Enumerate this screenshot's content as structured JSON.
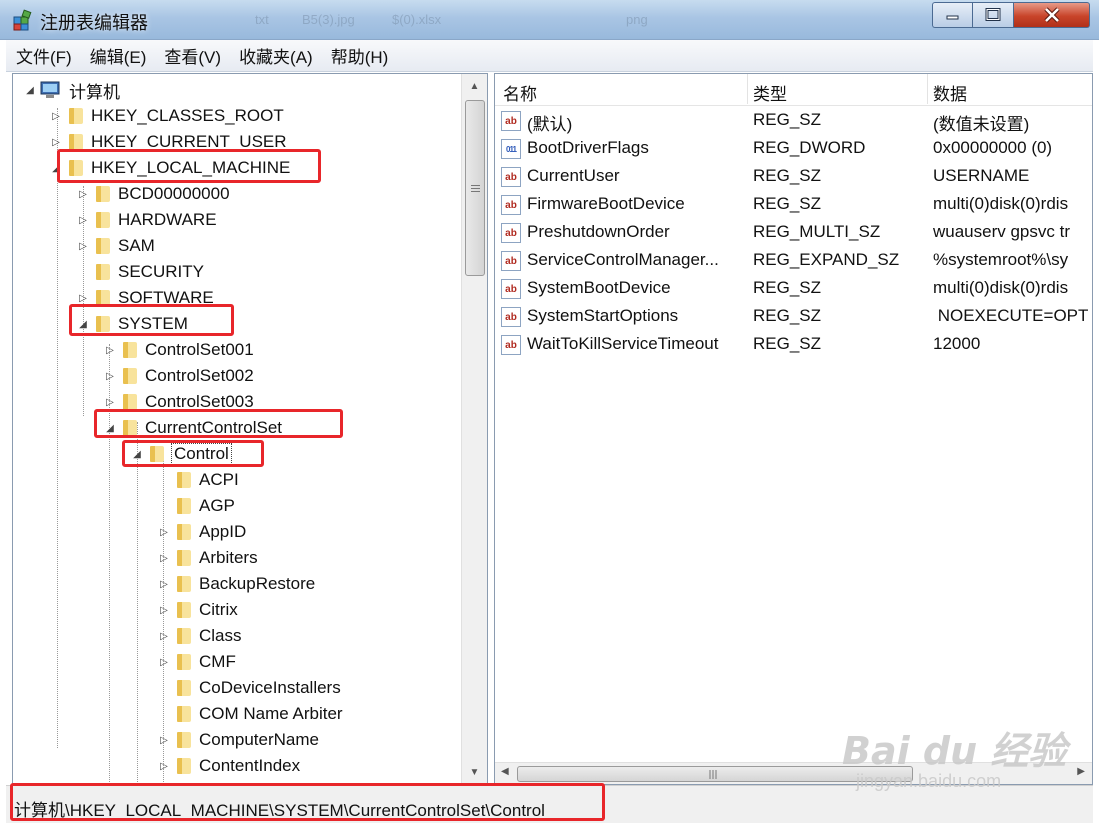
{
  "window": {
    "title": "注册表编辑器",
    "ghost_tabs": [
      "txt",
      "B5(3).jpg",
      "$(0).xlsx",
      "png"
    ]
  },
  "menubar": {
    "items": [
      "文件(F)",
      "编辑(E)",
      "查看(V)",
      "收藏夹(A)",
      "帮助(H)"
    ]
  },
  "tree": {
    "nodes": [
      {
        "label": "计算机",
        "toggle": "◢",
        "icon": "computer-icon"
      },
      {
        "label": "HKEY_CLASSES_ROOT",
        "toggle": "▷"
      },
      {
        "label": "HKEY_CURRENT_USER",
        "toggle": "▷"
      },
      {
        "label": "HKEY_LOCAL_MACHINE",
        "toggle": "◢"
      },
      {
        "label": "BCD00000000",
        "toggle": "▷"
      },
      {
        "label": "HARDWARE",
        "toggle": "▷"
      },
      {
        "label": "SAM",
        "toggle": "▷"
      },
      {
        "label": "SECURITY",
        "toggle": ""
      },
      {
        "label": "SOFTWARE",
        "toggle": "▷"
      },
      {
        "label": "SYSTEM",
        "toggle": "◢"
      },
      {
        "label": "ControlSet001",
        "toggle": "▷"
      },
      {
        "label": "ControlSet002",
        "toggle": "▷"
      },
      {
        "label": "ControlSet003",
        "toggle": "▷"
      },
      {
        "label": "CurrentControlSet",
        "toggle": "◢"
      },
      {
        "label": "Control",
        "toggle": "◢"
      },
      {
        "label": "ACPI",
        "toggle": ""
      },
      {
        "label": "AGP",
        "toggle": ""
      },
      {
        "label": "AppID",
        "toggle": "▷"
      },
      {
        "label": "Arbiters",
        "toggle": "▷"
      },
      {
        "label": "BackupRestore",
        "toggle": "▷"
      },
      {
        "label": "Citrix",
        "toggle": "▷"
      },
      {
        "label": "Class",
        "toggle": "▷"
      },
      {
        "label": "CMF",
        "toggle": "▷"
      },
      {
        "label": "CoDeviceInstallers",
        "toggle": ""
      },
      {
        "label": "COM Name Arbiter",
        "toggle": ""
      },
      {
        "label": "ComputerName",
        "toggle": "▷"
      },
      {
        "label": "ContentIndex",
        "toggle": "▷"
      }
    ]
  },
  "list": {
    "columns": [
      "名称",
      "类型",
      "数据"
    ],
    "rows": [
      {
        "icon": "ab",
        "name": "(默认)",
        "type": "REG_SZ",
        "data": "(数值未设置)"
      },
      {
        "icon": "011",
        "name": "BootDriverFlags",
        "type": "REG_DWORD",
        "data": "0x00000000 (0)"
      },
      {
        "icon": "ab",
        "name": "CurrentUser",
        "type": "REG_SZ",
        "data": "USERNAME"
      },
      {
        "icon": "ab",
        "name": "FirmwareBootDevice",
        "type": "REG_SZ",
        "data": "multi(0)disk(0)rdis"
      },
      {
        "icon": "ab",
        "name": "PreshutdownOrder",
        "type": "REG_MULTI_SZ",
        "data": "wuauserv gpsvc tr"
      },
      {
        "icon": "ab",
        "name": "ServiceControlManager...",
        "type": "REG_EXPAND_SZ",
        "data": "%systemroot%\\sy"
      },
      {
        "icon": "ab",
        "name": "SystemBootDevice",
        "type": "REG_SZ",
        "data": "multi(0)disk(0)rdis"
      },
      {
        "icon": "ab",
        "name": "SystemStartOptions",
        "type": "REG_SZ",
        "data": " NOEXECUTE=OPT"
      },
      {
        "icon": "ab",
        "name": "WaitToKillServiceTimeout",
        "type": "REG_SZ",
        "data": "12000"
      }
    ]
  },
  "statusbar": {
    "path": "计算机\\HKEY_LOCAL_MACHINE\\SYSTEM\\CurrentControlSet\\Control"
  },
  "watermark": {
    "logo": "Bai du 经验",
    "sub": "jingyan.baidu.com"
  },
  "colors": {
    "annotation": "#e8262a",
    "folder": "#e9c04f",
    "title_gradient_top": "#c7dcef"
  }
}
